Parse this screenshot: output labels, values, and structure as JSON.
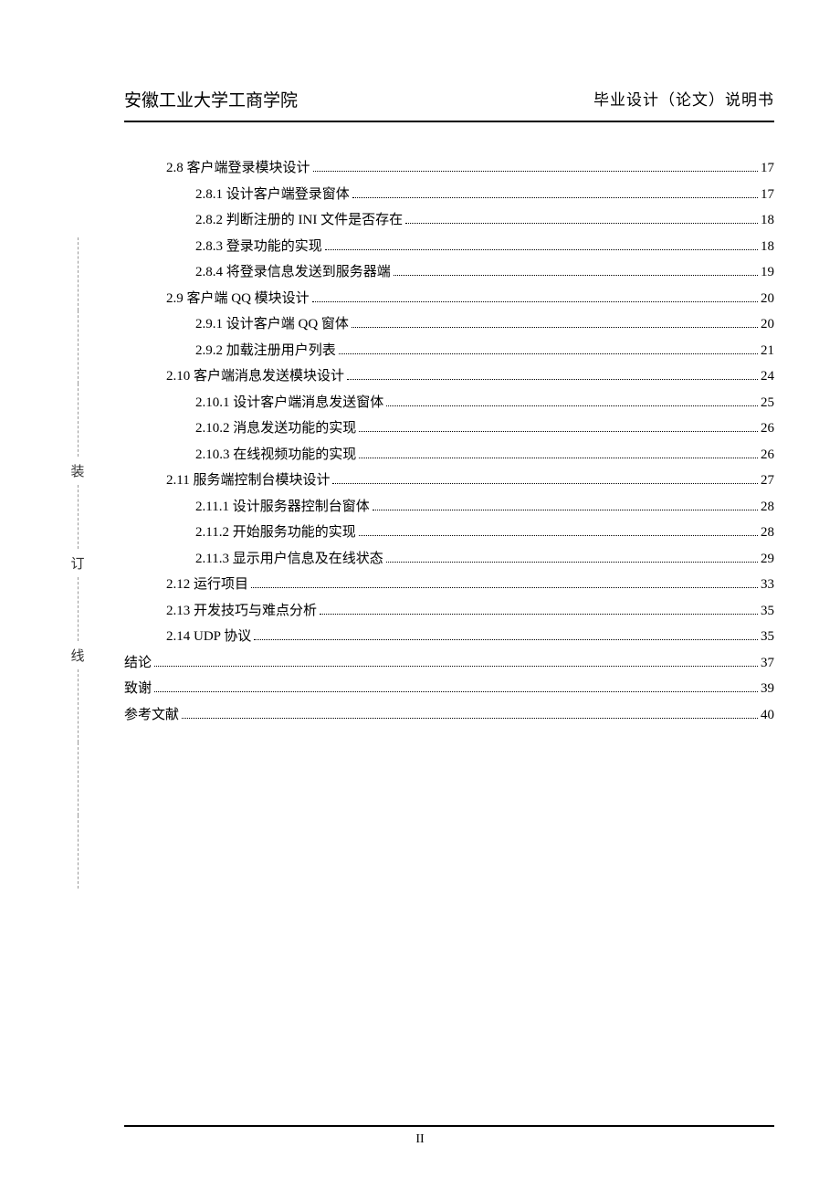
{
  "header": {
    "left": "安徽工业大学工商学院",
    "right": "毕业设计（论文）说明书"
  },
  "binding": {
    "char1": "装",
    "char2": "订",
    "char3": "线"
  },
  "toc": [
    {
      "indent": 1,
      "label": "2.8  客户端登录模块设计",
      "page": "17"
    },
    {
      "indent": 2,
      "label": "2.8.1  设计客户端登录窗体",
      "page": "17"
    },
    {
      "indent": 2,
      "label": "2.8.2  判断注册的 INI 文件是否存在",
      "page": "18"
    },
    {
      "indent": 2,
      "label": "2.8.3  登录功能的实现",
      "page": "18"
    },
    {
      "indent": 2,
      "label": "2.8.4  将登录信息发送到服务器端",
      "page": "19"
    },
    {
      "indent": 1,
      "label": "2.9  客户端 QQ 模块设计",
      "page": "20"
    },
    {
      "indent": 2,
      "label": "2.9.1  设计客户端 QQ 窗体",
      "page": "20"
    },
    {
      "indent": 2,
      "label": "2.9.2  加载注册用户列表",
      "page": "21"
    },
    {
      "indent": 1,
      "label": "2.10  客户端消息发送模块设计",
      "page": "24"
    },
    {
      "indent": 2,
      "label": "2.10.1  设计客户端消息发送窗体",
      "page": "25"
    },
    {
      "indent": 2,
      "label": "2.10.2  消息发送功能的实现",
      "page": "26"
    },
    {
      "indent": 2,
      "label": "2.10.3  在线视频功能的实现",
      "page": "26"
    },
    {
      "indent": 1,
      "label": "2.11  服务端控制台模块设计",
      "page": "27"
    },
    {
      "indent": 2,
      "label": "2.11.1  设计服务器控制台窗体",
      "page": "28"
    },
    {
      "indent": 2,
      "label": "2.11.2  开始服务功能的实现",
      "page": "28"
    },
    {
      "indent": 2,
      "label": "2.11.3  显示用户信息及在线状态",
      "page": "29"
    },
    {
      "indent": 1,
      "label": "2.12  运行项目",
      "page": "33"
    },
    {
      "indent": 1,
      "label": "2.13  开发技巧与难点分析",
      "page": "35"
    },
    {
      "indent": 1,
      "label": "2.14 UDP 协议",
      "page": "35"
    },
    {
      "indent": 0,
      "label": "结论",
      "page": "37"
    },
    {
      "indent": 0,
      "label": "致谢",
      "page": "39"
    },
    {
      "indent": 0,
      "label": "参考文献",
      "page": "40"
    }
  ],
  "pageNumber": "II"
}
